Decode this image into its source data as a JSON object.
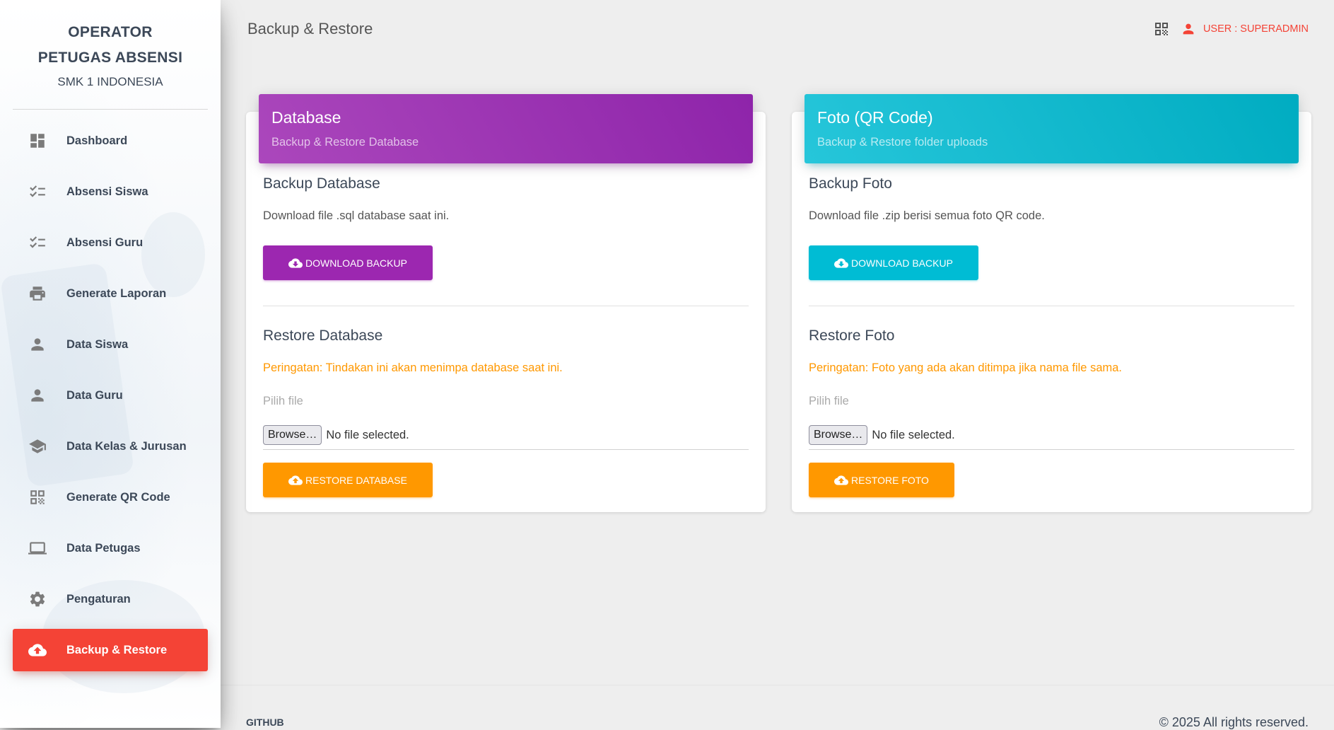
{
  "sidebar": {
    "brand": {
      "line1": "OPERATOR",
      "line2": "PETUGAS ABSENSI",
      "line3": "SMK 1 INDONESIA"
    },
    "items": [
      {
        "label": "Dashboard",
        "icon": "dashboard-icon"
      },
      {
        "label": "Absensi Siswa",
        "icon": "checklist-icon"
      },
      {
        "label": "Absensi Guru",
        "icon": "checklist-icon"
      },
      {
        "label": "Generate Laporan",
        "icon": "print-icon"
      },
      {
        "label": "Data Siswa",
        "icon": "person-icon"
      },
      {
        "label": "Data Guru",
        "icon": "person-icon"
      },
      {
        "label": "Data Kelas & Jurusan",
        "icon": "school-icon"
      },
      {
        "label": "Generate QR Code",
        "icon": "qr-code-icon"
      },
      {
        "label": "Data Petugas",
        "icon": "laptop-icon"
      },
      {
        "label": "Pengaturan",
        "icon": "gear-icon"
      },
      {
        "label": "Backup & Restore",
        "icon": "cloud-upload-icon",
        "active": true
      }
    ]
  },
  "navbar": {
    "title": "Backup & Restore",
    "qr_icon": "qr-code-icon",
    "user_label": "USER : SUPERADMIN"
  },
  "cards": {
    "database": {
      "title": "Database",
      "subtitle": "Backup & Restore Database",
      "backup_title": "Backup Database",
      "backup_desc": "Download file .sql database saat ini.",
      "download_label": "DOWNLOAD BACKUP",
      "restore_title": "Restore Database",
      "warning": "Peringatan: Tindakan ini akan menimpa database saat ini.",
      "file_label": "Pilih file",
      "browse_label": "Browse…",
      "no_file": "No file selected.",
      "restore_label": "RESTORE DATABASE",
      "color": "#9c27b0"
    },
    "foto": {
      "title": "Foto (QR Code)",
      "subtitle": "Backup & Restore folder uploads",
      "backup_title": "Backup Foto",
      "backup_desc": "Download file .zip berisi semua foto QR code.",
      "download_label": "DOWNLOAD BACKUP",
      "restore_title": "Restore Foto",
      "warning": "Peringatan: Foto yang ada akan ditimpa jika nama file sama.",
      "file_label": "Pilih file",
      "browse_label": "Browse…",
      "no_file": "No file selected.",
      "restore_label": "RESTORE FOTO",
      "color": "#00bcd4"
    }
  },
  "footer": {
    "link": "GITHUB",
    "copyright": "© 2025 All rights reserved."
  },
  "colors": {
    "accent_red": "#f44336",
    "warning_orange": "#ff9800"
  }
}
